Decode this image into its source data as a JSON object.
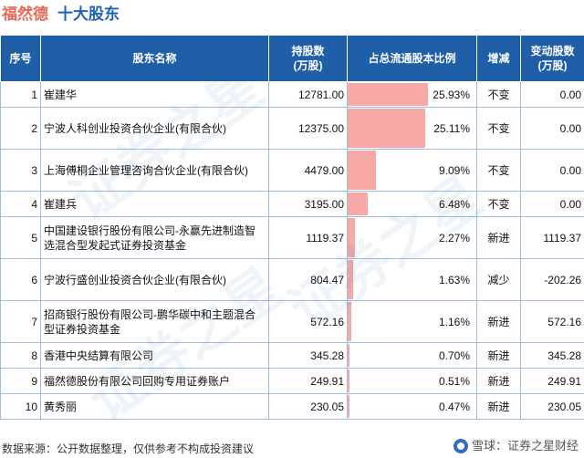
{
  "header": {
    "company": "福然德",
    "section": "十大股东"
  },
  "columns": [
    "序号",
    "股东名称",
    "持股数\n(万股)",
    "占总流通股本比例",
    "增减",
    "变动股数\n(万股)"
  ],
  "chart_data": {
    "type": "table",
    "bar_column": "占总流通股本比例",
    "bar_color": "#f7a9a5",
    "rows": [
      {
        "rank": "1",
        "name": "崔建华",
        "shares": "12781.00",
        "ratio": 25.93,
        "ratio_label": "25.93%",
        "change": "不变",
        "change_kind": "same",
        "delta": "0.00"
      },
      {
        "rank": "2",
        "name": "宁波人科创业投资合伙企业(有限合伙)",
        "shares": "12375.00",
        "ratio": 25.11,
        "ratio_label": "25.11%",
        "change": "不变",
        "change_kind": "same",
        "delta": "0.00"
      },
      {
        "rank": "3",
        "name": "上海傅桐企业管理咨询合伙企业(有限合伙)",
        "shares": "4479.00",
        "ratio": 9.09,
        "ratio_label": "9.09%",
        "change": "不变",
        "change_kind": "same",
        "delta": "0.00"
      },
      {
        "rank": "4",
        "name": "崔建兵",
        "shares": "3195.00",
        "ratio": 6.48,
        "ratio_label": "6.48%",
        "change": "不变",
        "change_kind": "same",
        "delta": "0.00"
      },
      {
        "rank": "5",
        "name": "中国建设银行股份有限公司-永赢先进制造智选混合型发起式证券投资基金",
        "shares": "1119.37",
        "ratio": 2.27,
        "ratio_label": "2.27%",
        "change": "新进",
        "change_kind": "new",
        "delta": "1119.37"
      },
      {
        "rank": "6",
        "name": "宁波行盛创业投资合伙企业(有限合伙)",
        "shares": "804.47",
        "ratio": 1.63,
        "ratio_label": "1.63%",
        "change": "减少",
        "change_kind": "down",
        "delta": "-202.26"
      },
      {
        "rank": "7",
        "name": "招商银行股份有限公司-鹏华碳中和主题混合型证券投资基金",
        "shares": "572.16",
        "ratio": 1.16,
        "ratio_label": "1.16%",
        "change": "新进",
        "change_kind": "new",
        "delta": "572.16"
      },
      {
        "rank": "8",
        "name": "香港中央结算有限公司",
        "shares": "345.28",
        "ratio": 0.7,
        "ratio_label": "0.70%",
        "change": "新进",
        "change_kind": "new",
        "delta": "345.28"
      },
      {
        "rank": "9",
        "name": "福然德股份有限公司回购专用证券账户",
        "shares": "249.91",
        "ratio": 0.51,
        "ratio_label": "0.51%",
        "change": "新进",
        "change_kind": "new",
        "delta": "249.91"
      },
      {
        "rank": "10",
        "name": "黄秀丽",
        "shares": "230.05",
        "ratio": 0.47,
        "ratio_label": "0.47%",
        "change": "新进",
        "change_kind": "new",
        "delta": "230.05"
      }
    ]
  },
  "watermark": "证券之星",
  "footer": {
    "source": "数据来源：公开数据整理，仅供参考不构成投资建议",
    "brand": "雪球：证券之星财经"
  }
}
